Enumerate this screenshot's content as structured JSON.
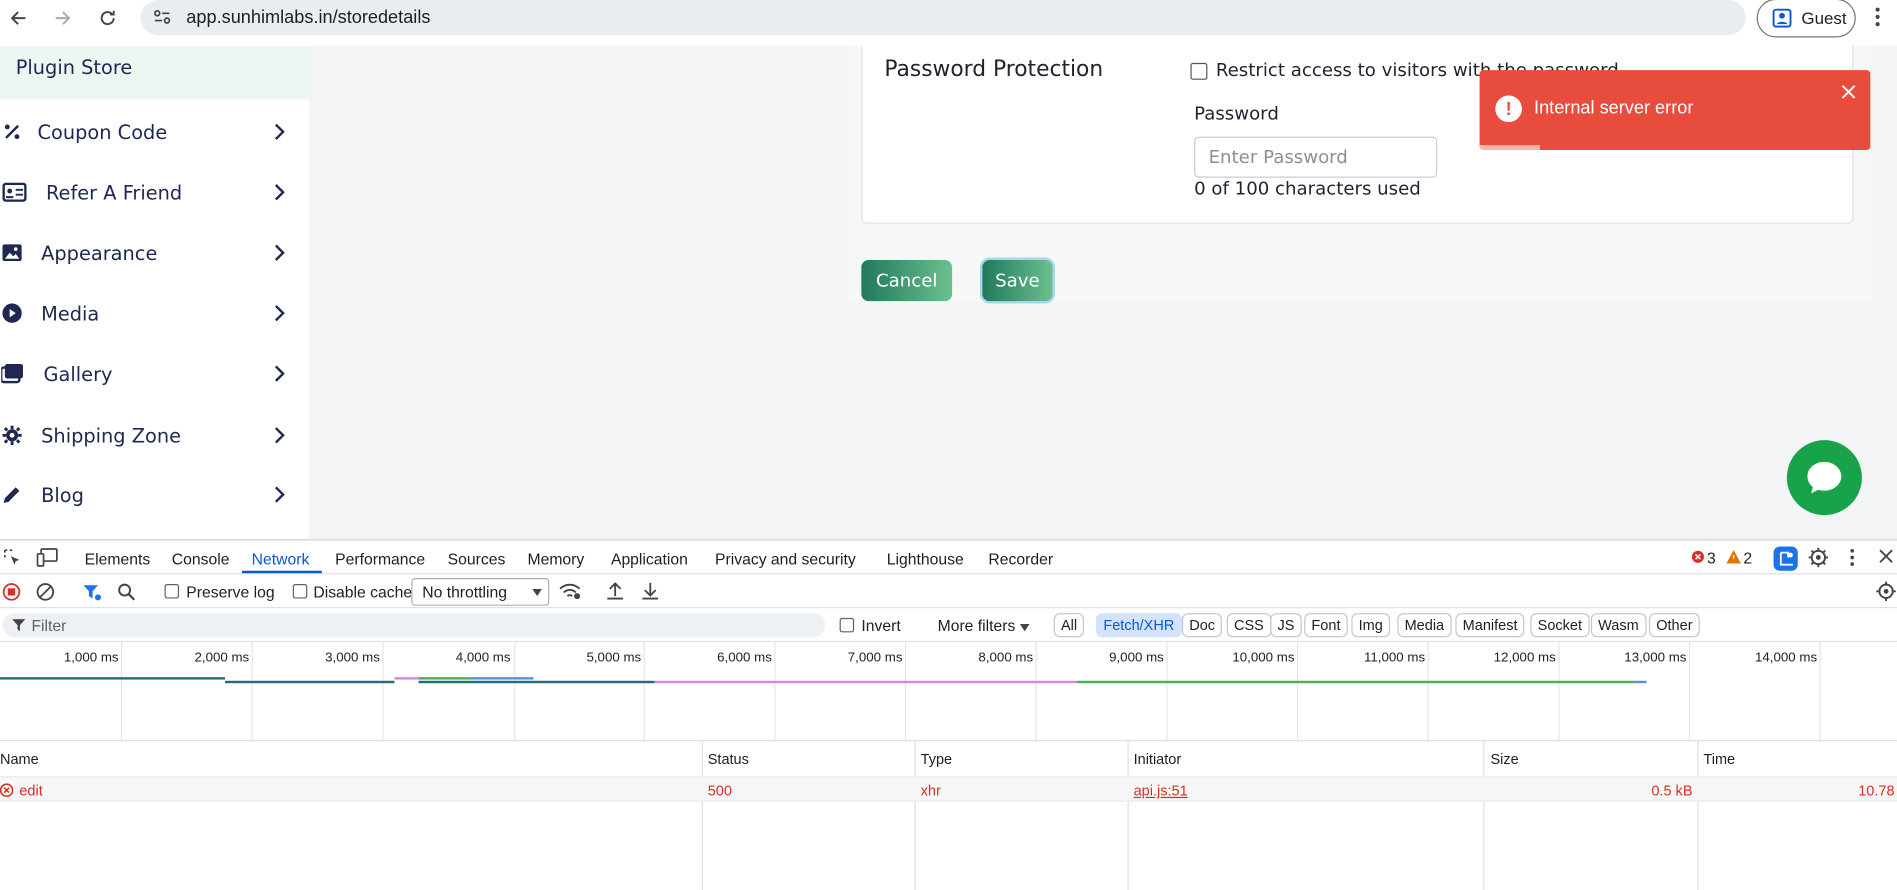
{
  "browser": {
    "url": "app.sunhimlabs.in/storedetails",
    "profile_label": "Guest"
  },
  "sidebar": {
    "header": "Plugin Store",
    "items": [
      {
        "label": "Coupon Code",
        "icon": "percent-icon"
      },
      {
        "label": "Refer A Friend",
        "icon": "id-card-icon"
      },
      {
        "label": "Appearance",
        "icon": "image-icon"
      },
      {
        "label": "Media",
        "icon": "play-circle-icon"
      },
      {
        "label": "Gallery",
        "icon": "images-icon"
      },
      {
        "label": "Shipping Zone",
        "icon": "gear-icon"
      },
      {
        "label": "Blog",
        "icon": "pencil-icon"
      }
    ]
  },
  "password_section": {
    "title": "Password Protection",
    "restrict_label": "Restrict access to visitors with the password",
    "password_label": "Password",
    "password_placeholder": "Enter Password",
    "char_count": "0 of 100 characters used"
  },
  "actions": {
    "cancel": "Cancel",
    "save": "Save"
  },
  "toast": {
    "message": "Internal server error",
    "color": "#e84c3d"
  },
  "devtools": {
    "tabs": [
      "Elements",
      "Console",
      "Network",
      "Performance",
      "Sources",
      "Memory",
      "Application",
      "Privacy and security",
      "Lighthouse",
      "Recorder"
    ],
    "active_tab": "Network",
    "errors": "3",
    "warnings": "2",
    "preserve_log": "Preserve log",
    "disable_cache": "Disable cache",
    "throttling": "No throttling",
    "filter_placeholder": "Filter",
    "invert": "Invert",
    "more_filters": "More filters",
    "type_filters": [
      "All",
      "Fetch/XHR",
      "Doc",
      "CSS",
      "JS",
      "Font",
      "Img",
      "Media",
      "Manifest",
      "Socket",
      "Wasm",
      "Other"
    ],
    "active_type_filter": "Fetch/XHR",
    "timeline_ticks": [
      "1,000 ms",
      "2,000 ms",
      "3,000 ms",
      "4,000 ms",
      "5,000 ms",
      "6,000 ms",
      "7,000 ms",
      "8,000 ms",
      "9,000 ms",
      "10,000 ms",
      "11,000 ms",
      "12,000 ms",
      "13,000 ms",
      "14,000 ms"
    ],
    "columns": [
      "Name",
      "Status",
      "Type",
      "Initiator",
      "Size",
      "Time"
    ],
    "rows": [
      {
        "name": "edit",
        "status": "500",
        "type": "xhr",
        "initiator": "api.js:51",
        "size": "0.5 kB",
        "time": "10.78"
      }
    ]
  }
}
